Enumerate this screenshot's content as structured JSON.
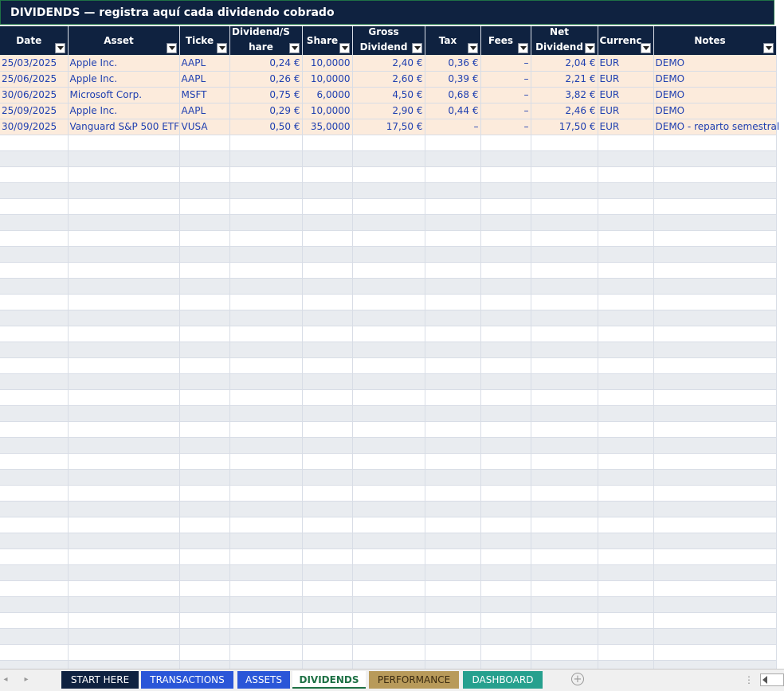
{
  "sheet_title": "DIVIDENDS  —  registra aquí cada dividendo cobrado",
  "columns": [
    "Date",
    "Asset",
    "Ticke",
    "Dividend/Share",
    "Share",
    "Gross Dividend",
    "Tax",
    "Fees",
    "Net Dividend",
    "Currenc",
    "Notes"
  ],
  "rows": [
    [
      "25/03/2025",
      "Apple Inc.",
      "AAPL",
      "0,24 €",
      "10,0000",
      "2,40 €",
      "0,36 €",
      "–",
      "2,04 €",
      "EUR",
      "DEMO"
    ],
    [
      "25/06/2025",
      "Apple Inc.",
      "AAPL",
      "0,26 €",
      "10,0000",
      "2,60 €",
      "0,39 €",
      "–",
      "2,21 €",
      "EUR",
      "DEMO"
    ],
    [
      "30/06/2025",
      "Microsoft Corp.",
      "MSFT",
      "0,75 €",
      "6,0000",
      "4,50 €",
      "0,68 €",
      "–",
      "3,82 €",
      "EUR",
      "DEMO"
    ],
    [
      "25/09/2025",
      "Apple Inc.",
      "AAPL",
      "0,29 €",
      "10,0000",
      "2,90 €",
      "0,44 €",
      "–",
      "2,46 €",
      "EUR",
      "DEMO"
    ],
    [
      "30/09/2025",
      "Vanguard S&P 500 ETF",
      "VUSA",
      "0,50 €",
      "35,0000",
      "17,50 €",
      "–",
      "–",
      "17,50 €",
      "EUR",
      "DEMO - reparto semestral"
    ]
  ],
  "sheet_tabs": [
    {
      "label": "START HERE",
      "color": "#0f2240"
    },
    {
      "label": "TRANSACTIONS",
      "color": "#2a56d8"
    },
    {
      "label": "ASSETS",
      "color": "#2a56d8"
    },
    {
      "label": "DIVIDENDS",
      "color": "#ffffff"
    },
    {
      "label": "PERFORMANCE",
      "color": "#b89a5a"
    },
    {
      "label": "DASHBOARD",
      "color": "#26a08e"
    }
  ],
  "active_tab": "DIVIDENDS"
}
